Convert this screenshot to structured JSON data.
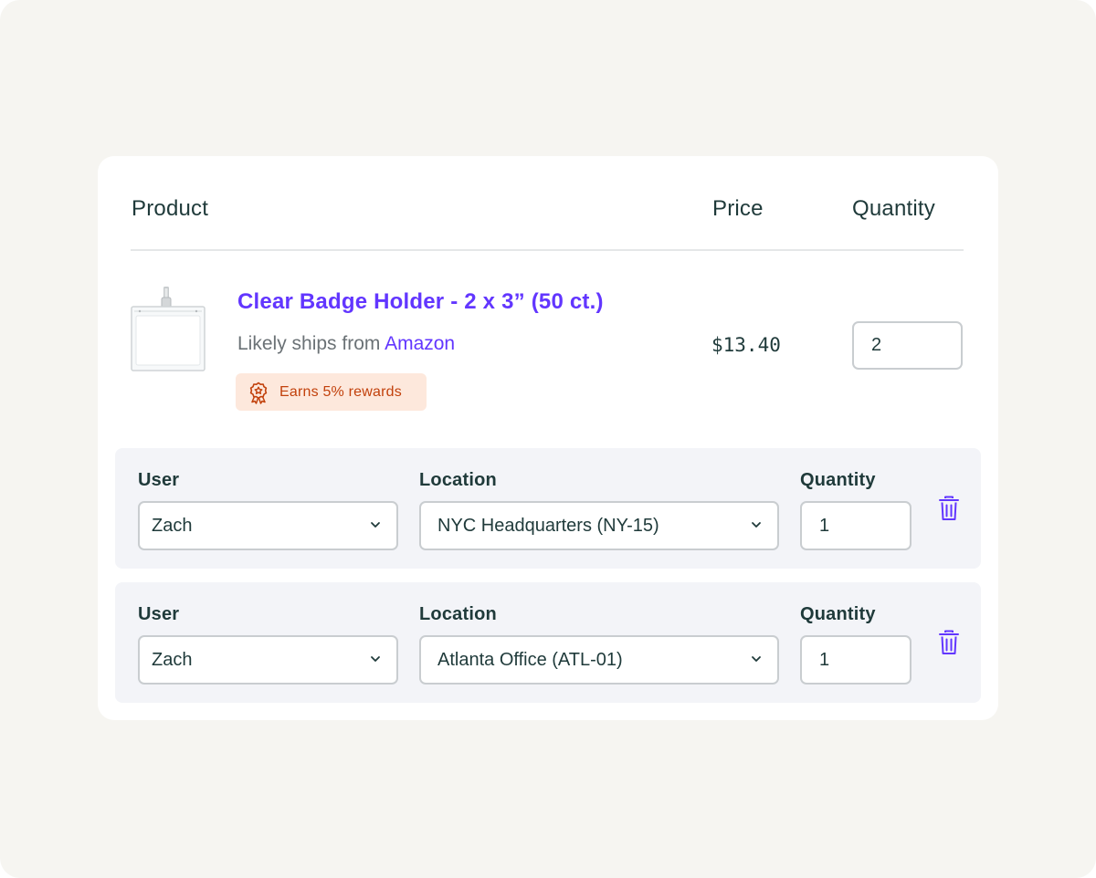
{
  "table": {
    "header_product": "Product",
    "header_price": "Price",
    "header_quantity": "Quantity"
  },
  "product": {
    "name": "Clear Badge Holder - 2 x 3” (50 ct.)",
    "ships_prefix": "Likely ships from",
    "ships_vendor": "Amazon",
    "rewards": "Earns 5% rewards",
    "price": "$13.40",
    "quantity": "2"
  },
  "allocations": [
    {
      "user_label": "User",
      "user_value": "Zach",
      "location_label": "Location",
      "location_value": "NYC Headquarters (NY-15)",
      "quantity_label": "Quantity",
      "quantity_value": "1"
    },
    {
      "user_label": "User",
      "user_value": "Zach",
      "location_label": "Location",
      "location_value": "Atlanta Office (ATL-01)",
      "quantity_label": "Quantity",
      "quantity_value": "1"
    }
  ],
  "colors": {
    "accent": "#6236ff",
    "text": "#1f3a3a",
    "rewards_bg": "#fde8dc",
    "rewards_text": "#c2410c"
  },
  "icons": [
    "badge-holder-image",
    "award-icon",
    "chevron-down-icon",
    "trash-icon"
  ]
}
